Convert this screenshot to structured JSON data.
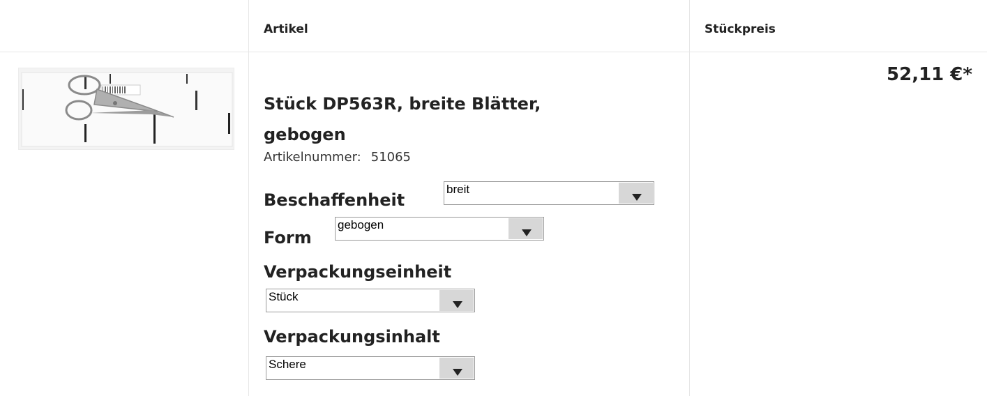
{
  "table": {
    "headers": {
      "artikel": "Artikel",
      "preis": "Stückpreis"
    }
  },
  "product": {
    "image_alt": "Schere im Beutel",
    "title": "Stück DP563R, breite Blätter, gebogen",
    "artikelnummer_label": "Artikelnummer:",
    "artikelnummer_value": "51065",
    "price": "52,11 €*"
  },
  "attributes": {
    "beschaffenheit": {
      "label": "Beschaffenheit",
      "value": "breit"
    },
    "form": {
      "label": "Form",
      "value": "gebogen"
    },
    "verpackungseinheit": {
      "label": "Verpackungseinheit",
      "value": "Stück"
    },
    "verpackungsinhalt": {
      "label": "Verpackungsinhalt",
      "value": "Schere"
    }
  }
}
